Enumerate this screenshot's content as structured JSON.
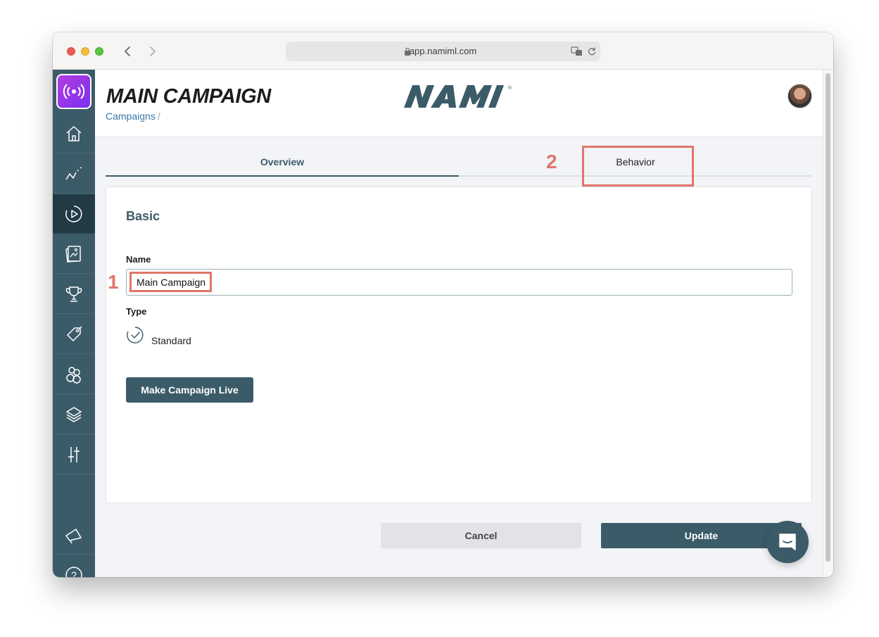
{
  "browser": {
    "url": "app.namiml.com"
  },
  "sidebar": {
    "items": [
      {
        "icon": "home-icon"
      },
      {
        "icon": "analytics-icon"
      },
      {
        "icon": "campaigns-icon",
        "active": true
      },
      {
        "icon": "paywalls-icon"
      },
      {
        "icon": "trophy-icon"
      },
      {
        "icon": "tag-icon"
      },
      {
        "icon": "users-icon"
      },
      {
        "icon": "layers-icon"
      },
      {
        "icon": "settings-sliders-icon"
      },
      {
        "icon": "announcement-icon"
      },
      {
        "icon": "help-icon"
      }
    ]
  },
  "header": {
    "title": "MAIN CAMPAIGN",
    "breadcrumb": "Campaigns",
    "breadcrumb_sep": "/",
    "brand": "NAMI"
  },
  "tabs": [
    {
      "label": "Overview",
      "active": true
    },
    {
      "label": "Behavior",
      "active": false
    }
  ],
  "form": {
    "section_title": "Basic",
    "name_label": "Name",
    "name_value": "Main Campaign",
    "type_label": "Type",
    "type_value": "Standard",
    "make_live_label": "Make Campaign Live"
  },
  "actions": {
    "cancel_label": "Cancel",
    "update_label": "Update"
  },
  "annotations": {
    "callout_1": "1",
    "callout_2": "2",
    "color": "#e0766a"
  },
  "colors": {
    "primary": "#3b5b68",
    "sidebar_active": "#213a44",
    "link": "#3a78a8"
  }
}
